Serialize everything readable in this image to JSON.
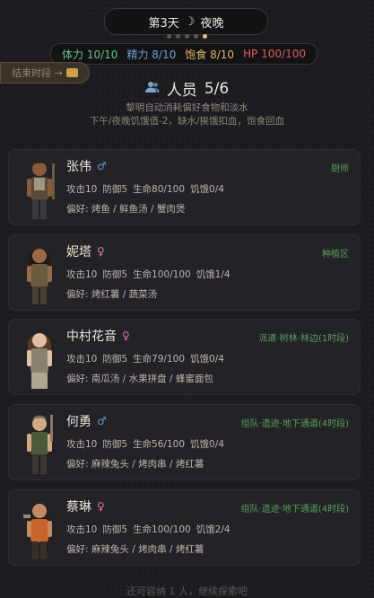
{
  "header": {
    "day": "第3天",
    "period": "夜晚"
  },
  "stats": [
    {
      "label": "体力",
      "value": "10/10",
      "color": "#66c28a"
    },
    {
      "label": "精力",
      "value": "8/10",
      "color": "#6e9fd6"
    },
    {
      "label": "饱食",
      "value": "8/10",
      "color": "#e0b760"
    },
    {
      "label": "HP",
      "value": "100/100",
      "color": "#e05a5a"
    }
  ],
  "end_phase_label": "结束时段 →",
  "section": {
    "title": "人员",
    "count": "5/6"
  },
  "description": {
    "line1": "黎明自动消耗偏好食物和淡水",
    "line2": "下午/夜晚饥饿值-2，缺水/挨饿扣血，饱食回血"
  },
  "survivors": [
    {
      "name": "张伟",
      "gender": "♂",
      "assignment": "厨师",
      "atk": "攻击10",
      "def": "防御5",
      "hp": "生命80/100",
      "hunger": "饥饿0/4",
      "pref_label": "偏好:",
      "prefs": "烤鱼 / 鲜鱼汤 / 蟹肉煲"
    },
    {
      "name": "妮塔",
      "gender": "♀",
      "assignment": "种植区",
      "atk": "攻击10",
      "def": "防御5",
      "hp": "生命100/100",
      "hunger": "饥饿1/4",
      "pref_label": "偏好:",
      "prefs": "烤红薯 / 蔬菜汤"
    },
    {
      "name": "中村花音",
      "gender": "♀",
      "assignment": "派遣·树林·林边(1时段)",
      "atk": "攻击10",
      "def": "防御5",
      "hp": "生命79/100",
      "hunger": "饥饿0/4",
      "pref_label": "偏好:",
      "prefs": "南瓜汤 / 水果拼盘 / 蜂蜜面包"
    },
    {
      "name": "何勇",
      "gender": "♂",
      "assignment": "组队·遗迹·地下通道(4时段)",
      "atk": "攻击10",
      "def": "防御5",
      "hp": "生命56/100",
      "hunger": "饥饿0/4",
      "pref_label": "偏好:",
      "prefs": "麻辣兔头 / 烤肉串 / 烤红薯"
    },
    {
      "name": "蔡琳",
      "gender": "♀",
      "assignment": "组队·遗迹·地下通道(4时段)",
      "atk": "攻击10",
      "def": "防御5",
      "hp": "生命100/100",
      "hunger": "饥饿2/4",
      "pref_label": "偏好:",
      "prefs": "麻辣兔头 / 烤肉串 / 烤红薯"
    }
  ],
  "footer": "还可容纳 1 人，继续探索吧"
}
